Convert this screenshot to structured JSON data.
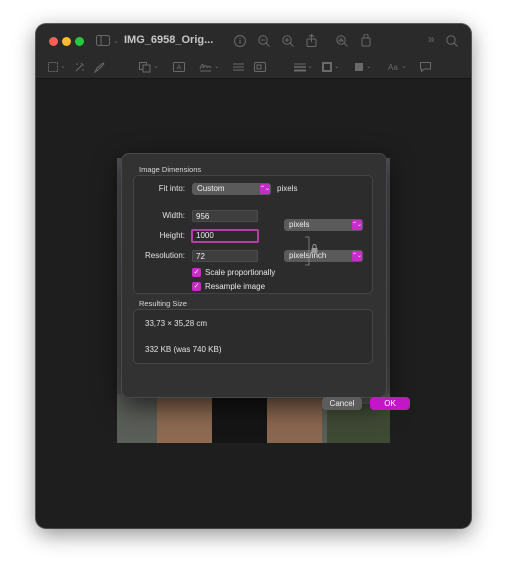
{
  "window": {
    "title": "IMG_6958_Orig...",
    "colors": {
      "accent": "#c62fc6",
      "background": "#1e1e1e"
    }
  },
  "toolbar": {
    "icons": [
      "sidebar-icon",
      "info-icon",
      "zoom-out-icon",
      "zoom-in-icon",
      "share-icon",
      "markup-icon",
      "search-icon",
      "more-icon",
      "selection-icon",
      "instant-alpha-icon",
      "sketch-icon",
      "text-icon",
      "sign-icon",
      "adjust-color-icon",
      "adjust-size-icon",
      "shape-style-icon",
      "border-color-icon",
      "fill-color-icon",
      "text-style-icon",
      "annotation-icon"
    ]
  },
  "dialog": {
    "image_dimensions_title": "Image Dimensions",
    "fit_into_label": "Fit into:",
    "fit_into_value": "Custom",
    "fit_into_unit": "pixels",
    "width_label": "Width:",
    "width_value": "956",
    "height_label": "Height:",
    "height_value": "1000",
    "unit_value": "pixels",
    "resolution_label": "Resolution:",
    "resolution_value": "72",
    "resolution_unit": "pixels/inch",
    "scale_label": "Scale proportionally",
    "scale_checked": true,
    "resample_label": "Resample image",
    "resample_checked": true,
    "resulting_size_title": "Resulting Size",
    "resulting_dimensions": "33,73 × 35,28 cm",
    "resulting_filesize": "332 KB (was 740 KB)",
    "cancel_label": "Cancel",
    "ok_label": "OK",
    "check_glyph": "✓",
    "popup_chevron": "⌃⌄"
  }
}
